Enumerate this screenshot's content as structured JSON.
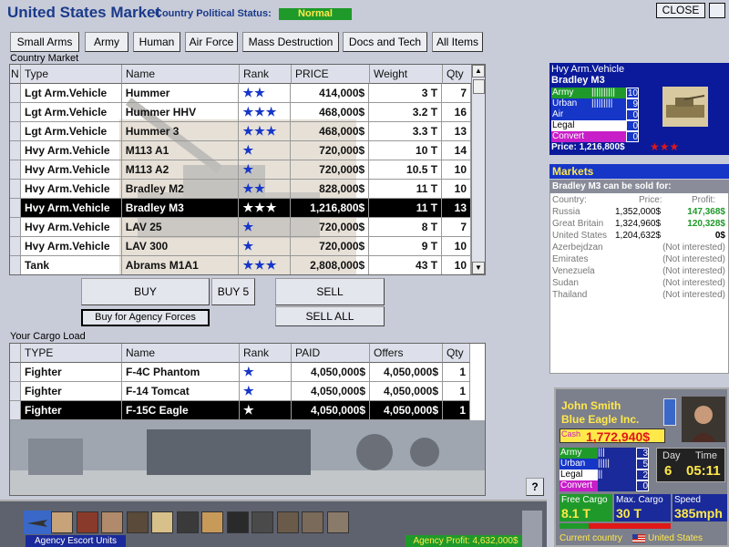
{
  "header": {
    "title": "United States Market",
    "status_label": "Country Political Status:",
    "status_value": "Normal",
    "close_label": "CLOSE"
  },
  "tabs": [
    "Small Arms",
    "Army",
    "Human",
    "Air Force",
    "Mass Destruction",
    "Docs and Tech",
    "All Items"
  ],
  "market": {
    "label": "Country Market",
    "columns": [
      "N",
      "Type",
      "Name",
      "Rank",
      "PRICE",
      "Weight",
      "Qty"
    ],
    "rows": [
      {
        "type": "Lgt Arm.Vehicle",
        "name": "Hummer",
        "rank": "★★",
        "price": "414,000$",
        "weight": "3 T",
        "qty": "7"
      },
      {
        "type": "Lgt Arm.Vehicle",
        "name": "Hummer HHV",
        "rank": "★★★",
        "price": "468,000$",
        "weight": "3.2 T",
        "qty": "16"
      },
      {
        "type": "Lgt Arm.Vehicle",
        "name": "Hummer 3",
        "rank": "★★★",
        "price": "468,000$",
        "weight": "3.3 T",
        "qty": "13"
      },
      {
        "type": "Hvy Arm.Vehicle",
        "name": "M113 A1",
        "rank": "★",
        "price": "720,000$",
        "weight": "10 T",
        "qty": "14"
      },
      {
        "type": "Hvy Arm.Vehicle",
        "name": "M113 A2",
        "rank": "★",
        "price": "720,000$",
        "weight": "10.5 T",
        "qty": "10"
      },
      {
        "type": "Hvy Arm.Vehicle",
        "name": "Bradley M2",
        "rank": "★★",
        "price": "828,000$",
        "weight": "11 T",
        "qty": "10"
      },
      {
        "type": "Hvy Arm.Vehicle",
        "name": "Bradley M3",
        "rank": "★★★",
        "price": "1,216,800$",
        "weight": "11 T",
        "qty": "13"
      },
      {
        "type": "Hvy Arm.Vehicle",
        "name": "LAV 25",
        "rank": "★",
        "price": "720,000$",
        "weight": "8 T",
        "qty": "7"
      },
      {
        "type": "Hvy Arm.Vehicle",
        "name": "LAV 300",
        "rank": "★",
        "price": "720,000$",
        "weight": "9 T",
        "qty": "10"
      },
      {
        "type": "Tank",
        "name": "Abrams M1A1",
        "rank": "★★★",
        "price": "2,808,000$",
        "weight": "43 T",
        "qty": "10"
      }
    ],
    "selected_index": 6
  },
  "actions": {
    "buy": "BUY",
    "buy5": "BUY 5",
    "sell": "SELL",
    "buy_agency": "Buy for Agency Forces",
    "sell_all": "SELL ALL"
  },
  "cargo": {
    "label": "Your Cargo Load",
    "columns": [
      "TYPE",
      "Name",
      "Rank",
      "PAID",
      "Offers",
      "Qty"
    ],
    "rows": [
      {
        "type": "Fighter",
        "name": "F-4C Phantom",
        "rank": "★",
        "paid": "4,050,000$",
        "offer": "4,050,000$",
        "qty": "1"
      },
      {
        "type": "Fighter",
        "name": "F-14 Tomcat",
        "rank": "★",
        "paid": "4,050,000$",
        "offer": "4,050,000$",
        "qty": "1"
      },
      {
        "type": "Fighter",
        "name": "F-15C Eagle",
        "rank": "★",
        "paid": "4,050,000$",
        "offer": "4,050,000$",
        "qty": "1"
      }
    ],
    "selected_index": 2
  },
  "vehicle": {
    "category": "Hvy Arm.Vehicle",
    "name": "Bradley M3",
    "stats": [
      {
        "label": "Army",
        "value": "10",
        "color": "#1f9a2a"
      },
      {
        "label": "Urban",
        "value": "9",
        "color": "#1636c8"
      },
      {
        "label": "Air",
        "value": "0",
        "color": "#1636c8"
      },
      {
        "label": "Legal",
        "value": "0",
        "color": "#ffffff"
      },
      {
        "label": "Convert",
        "value": "0",
        "color": "#c81ec8"
      }
    ],
    "price": "Price: 1,216,800$",
    "rank": "★★★"
  },
  "markets": {
    "title": "Markets",
    "subtitle": "Bradley M3 can be sold for:",
    "columns": [
      "Country:",
      "Price:",
      "Profit:"
    ],
    "rows": [
      {
        "country": "Russia",
        "price": "1,352,000$",
        "profit": "147,368$"
      },
      {
        "country": "Great Britain",
        "price": "1,324,960$",
        "profit": "120,328$"
      },
      {
        "country": "United States",
        "price": "1,204,632$",
        "profit": "0$"
      },
      {
        "country": "Azerbejdzan",
        "price": "",
        "profit": "(Not interested)"
      },
      {
        "country": "Emirates",
        "price": "",
        "profit": "(Not interested)"
      },
      {
        "country": "Venezuela",
        "price": "",
        "profit": "(Not interested)"
      },
      {
        "country": "Sudan",
        "price": "",
        "profit": "(Not interested)"
      },
      {
        "country": "Thailand",
        "price": "",
        "profit": "(Not interested)"
      }
    ]
  },
  "player": {
    "name": "John Smith",
    "company": "Blue Eagle Inc.",
    "cash_label": "Cash",
    "cash": "1,772,940$",
    "stats": [
      {
        "label": "Army",
        "value": "3"
      },
      {
        "label": "Urban",
        "value": "5"
      },
      {
        "label": "Legal",
        "value": "2"
      },
      {
        "label": "Convert",
        "value": "0"
      }
    ],
    "day_label": "Day",
    "day": "6",
    "time_label": "Time",
    "time": "05:11",
    "free_cargo_label": "Free Cargo",
    "free_cargo": "8.1 T",
    "max_cargo_label": "Max. Cargo",
    "max_cargo": "30 T",
    "speed_label": "Speed",
    "speed": "385mph",
    "country_label": "Current country",
    "country": "United States"
  },
  "help_label": "?",
  "footer": {
    "escort_label": "Agency Escort Units",
    "profit": "Agency Profit: 4,632,000$"
  }
}
